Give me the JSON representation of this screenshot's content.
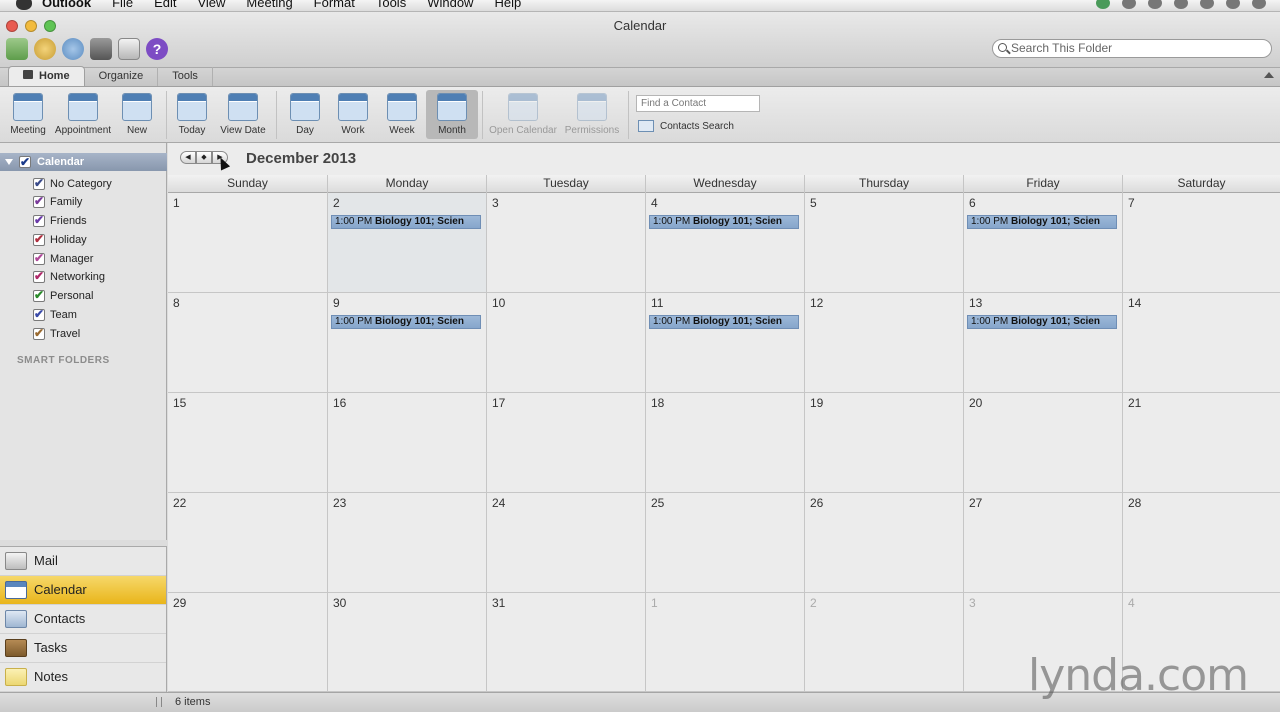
{
  "menubar": {
    "app_name": "Outlook",
    "items": [
      "File",
      "Edit",
      "View",
      "Meeting",
      "Format",
      "Tools",
      "Window",
      "Help"
    ]
  },
  "window": {
    "title": "Calendar"
  },
  "search": {
    "placeholder": "Search This Folder"
  },
  "tabs": [
    {
      "label": "Home"
    },
    {
      "label": "Organize"
    },
    {
      "label": "Tools"
    }
  ],
  "ribbon": {
    "meeting": "Meeting",
    "appointment": "Appointment",
    "new": "New",
    "today": "Today",
    "view_date": "View Date",
    "day": "Day",
    "work": "Work",
    "week": "Week",
    "month": "Month",
    "open_calendar": "Open Calendar",
    "permissions": "Permissions",
    "find_contact_placeholder": "Find a Contact",
    "contacts_search": "Contacts Search"
  },
  "sidebar": {
    "root": "Calendar",
    "categories": [
      {
        "label": "No Category",
        "color": "#3a4a8a"
      },
      {
        "label": "Family",
        "color": "#7a3a9a"
      },
      {
        "label": "Friends",
        "color": "#6a3aa8"
      },
      {
        "label": "Holiday",
        "color": "#b03040"
      },
      {
        "label": "Manager",
        "color": "#b04a9a"
      },
      {
        "label": "Networking",
        "color": "#b02a6a"
      },
      {
        "label": "Personal",
        "color": "#2a8a2a"
      },
      {
        "label": "Team",
        "color": "#3a4aa8"
      },
      {
        "label": "Travel",
        "color": "#9a6a30"
      }
    ],
    "smart_folders": "SMART FOLDERS"
  },
  "nav": {
    "mail": "Mail",
    "calendar": "Calendar",
    "contacts": "Contacts",
    "tasks": "Tasks",
    "notes": "Notes"
  },
  "calendar": {
    "month_title": "December 2013",
    "weekdays": [
      "Sunday",
      "Monday",
      "Tuesday",
      "Wednesday",
      "Thursday",
      "Friday",
      "Saturday"
    ],
    "weeks": [
      [
        "1",
        "2",
        "3",
        "4",
        "5",
        "6",
        "7"
      ],
      [
        "8",
        "9",
        "10",
        "11",
        "12",
        "13",
        "14"
      ],
      [
        "15",
        "16",
        "17",
        "18",
        "19",
        "20",
        "21"
      ],
      [
        "22",
        "23",
        "24",
        "25",
        "26",
        "27",
        "28"
      ],
      [
        "29",
        "30",
        "31",
        "1",
        "2",
        "3",
        "4"
      ]
    ],
    "event_time": "1:00 PM",
    "event_title": "Biology 101; Scien"
  },
  "status": {
    "count": "6 items"
  },
  "watermark": "lynda.com"
}
